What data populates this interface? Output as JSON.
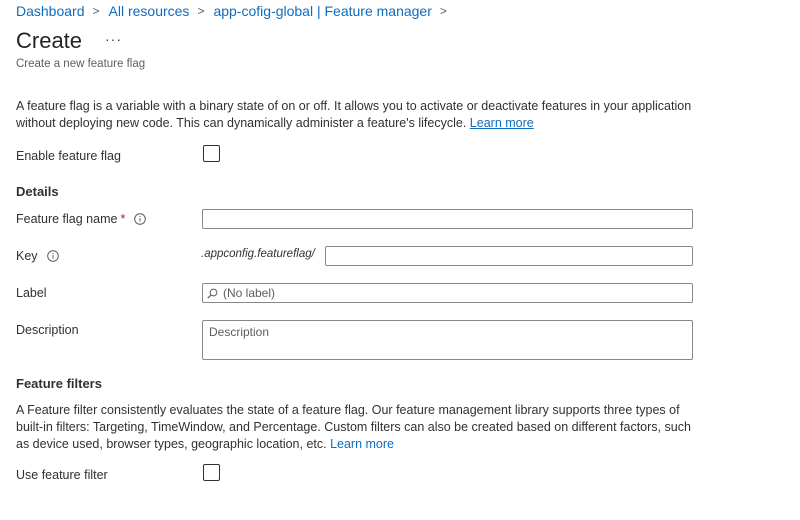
{
  "breadcrumb": {
    "items": [
      "Dashboard",
      "All resources",
      "app-cofig-global | Feature manager"
    ],
    "separator": ">"
  },
  "header": {
    "title": "Create",
    "more": "···",
    "subtitle": "Create a new feature flag"
  },
  "intro": {
    "text": "A feature flag is a variable with a binary state of on or off. It allows you to activate or deactivate features in your application without deploying new code. This can dynamically administer a feature's lifecycle.",
    "link": "Learn more"
  },
  "enable": {
    "label": "Enable feature flag",
    "checked": false
  },
  "details": {
    "heading": "Details",
    "name_label": "Feature flag name",
    "required_mark": "*",
    "name_value": "",
    "key_label": "Key",
    "key_prefix": ".appconfig.featureflag/",
    "key_value": "",
    "label_label": "Label",
    "label_placeholder": "(No label)",
    "description_label": "Description",
    "description_placeholder": "Description"
  },
  "filters": {
    "heading": "Feature filters",
    "text": "A Feature filter consistently evaluates the state of a feature flag. Our feature management library supports three types of built-in filters: Targeting, TimeWindow, and Percentage. Custom filters can also be created based on different factors, such as device used, browser types, geographic location, etc.",
    "link": "Learn more",
    "use_label": "Use feature filter",
    "use_checked": false
  },
  "colors": {
    "link": "#0f6cbd",
    "required": "#a4262c",
    "text": "#323130"
  },
  "icons": {
    "info": "info-icon",
    "search": "search-icon",
    "separator": "chevron-right-icon"
  }
}
